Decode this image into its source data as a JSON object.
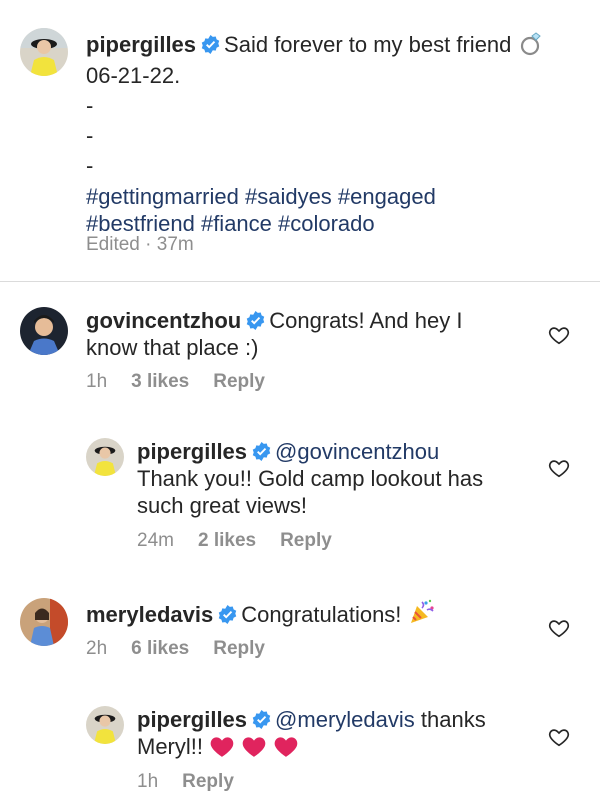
{
  "caption": {
    "username": "pipergilles",
    "text": "Said forever to my best friend",
    "line2": "06-21-22.",
    "dashes": [
      "-",
      "-",
      "-"
    ],
    "hashtags_line1": "#gettingmarried #saidyes #engaged",
    "hashtags_line2": "#bestfriend #fiance #colorado",
    "meta": "Edited · 37m",
    "emoji": "ring-icon"
  },
  "comments": [
    {
      "username": "govincentzhou",
      "text_line1": "Congrats! And hey I",
      "text_line2": "know that place :)",
      "time": "1h",
      "likes": "3 likes",
      "reply": "Reply"
    },
    {
      "username": "pipergilles",
      "mention": "@govincentzhou",
      "text_line1": "Thank you!! Gold camp lookout has",
      "text_line2": "such great views!",
      "time": "24m",
      "likes": "2 likes",
      "reply": "Reply"
    },
    {
      "username": "meryledavis",
      "text_line1": "Congratulations!",
      "emoji": "party-popper-icon",
      "time": "2h",
      "likes": "6 likes",
      "reply": "Reply"
    },
    {
      "username": "pipergilles",
      "mention": "@meryledavis",
      "text_after_mention": "thanks",
      "text_line2": "Meryl!!",
      "emoji": "red-heart-icon",
      "time": "1h",
      "reply": "Reply"
    }
  ],
  "colors": {
    "verified": "#3897f0",
    "hashtag": "#223a66",
    "meta": "#8e8e8e",
    "heart_emoji": "#e0245e"
  }
}
